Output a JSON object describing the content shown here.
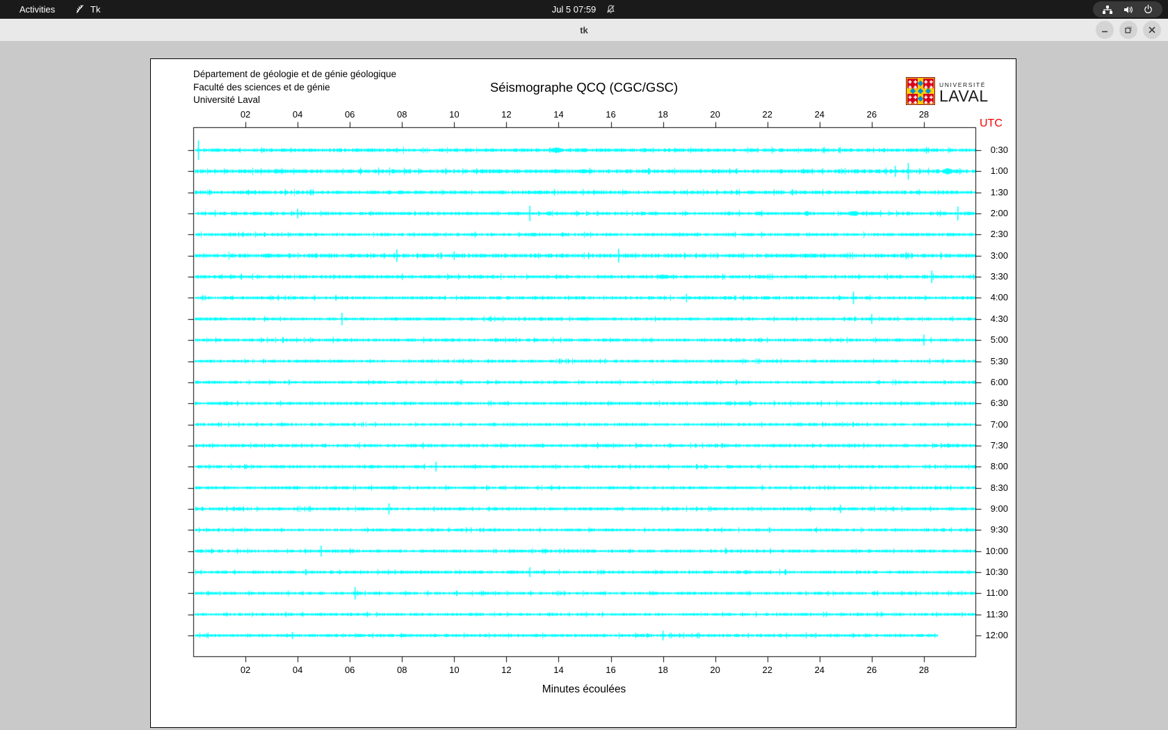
{
  "topbar": {
    "activities": "Activities",
    "app_name": "Tk",
    "clock": "Jul 5 07:59",
    "icon_names": [
      "tk-feather-icon",
      "bell-muted-icon",
      "network-icon",
      "volume-icon",
      "power-icon"
    ]
  },
  "titlebar": {
    "title": "tk",
    "controls": [
      "minimize",
      "maximize",
      "close"
    ]
  },
  "panel": {
    "dept_lines": [
      "Département de géologie et de génie géologique",
      "Faculté des sciences et de génie",
      "Université Laval"
    ],
    "title": "Séismographe QCQ (CGC/GSC)",
    "logo_top": "UNIVERSITÉ",
    "logo_bottom": "LAVAL"
  },
  "chart_data": {
    "type": "line",
    "subtype": "helicorder-seismogram",
    "title": "Séismographe QCQ (CGC/GSC)",
    "xlabel": "Minutes écoulées",
    "ylabel_right": "UTC",
    "x_range_minutes": [
      0,
      30
    ],
    "x_tick_minutes": [
      2,
      4,
      6,
      8,
      10,
      12,
      14,
      16,
      18,
      20,
      22,
      24,
      26,
      28
    ],
    "x_tick_labels": [
      "02",
      "04",
      "06",
      "08",
      "10",
      "12",
      "14",
      "16",
      "18",
      "20",
      "22",
      "24",
      "26",
      "28"
    ],
    "minutes_per_row": 30,
    "trace_color": "#00ffff",
    "axis_color": "#000000",
    "utc_color": "#f20000",
    "traces": [
      {
        "utc": "0:30",
        "amp": 1.8,
        "end": 30,
        "spikes": [
          {
            "m": 0.2,
            "a": 14
          }
        ],
        "bursts": [
          {
            "m": 13.9,
            "w": 0.6,
            "a": 4.5
          }
        ]
      },
      {
        "utc": "1:00",
        "amp": 2.0,
        "end": 30,
        "spikes": [
          {
            "m": 26.9,
            "a": 8
          },
          {
            "m": 27.4,
            "a": 12
          }
        ],
        "bursts": [
          {
            "m": 28.9,
            "w": 0.5,
            "a": 5
          }
        ]
      },
      {
        "utc": "1:30",
        "amp": 1.8,
        "end": 30,
        "spikes": [],
        "bursts": []
      },
      {
        "utc": "2:00",
        "amp": 1.7,
        "end": 30,
        "spikes": [
          {
            "m": 4.0,
            "a": 7
          },
          {
            "m": 12.9,
            "a": 11
          },
          {
            "m": 29.3,
            "a": 10
          }
        ],
        "bursts": [
          {
            "m": 23.5,
            "w": 0.4,
            "a": 3.5
          },
          {
            "m": 25.3,
            "w": 0.5,
            "a": 4.5
          }
        ]
      },
      {
        "utc": "2:30",
        "amp": 1.6,
        "end": 30,
        "spikes": [],
        "bursts": []
      },
      {
        "utc": "3:00",
        "amp": 2.0,
        "end": 30,
        "spikes": [
          {
            "m": 7.8,
            "a": 9
          },
          {
            "m": 9.5,
            "a": 5
          },
          {
            "m": 10.0,
            "a": 6
          },
          {
            "m": 16.3,
            "a": 10
          }
        ],
        "bursts": []
      },
      {
        "utc": "3:30",
        "amp": 1.7,
        "end": 30,
        "spikes": [
          {
            "m": 28.3,
            "a": 9
          }
        ],
        "bursts": [
          {
            "m": 18.0,
            "w": 0.8,
            "a": 3.5
          }
        ]
      },
      {
        "utc": "4:00",
        "amp": 1.6,
        "end": 30,
        "spikes": [
          {
            "m": 18.9,
            "a": 6
          },
          {
            "m": 25.3,
            "a": 9
          }
        ],
        "bursts": []
      },
      {
        "utc": "4:30",
        "amp": 1.6,
        "end": 30,
        "spikes": [
          {
            "m": 5.7,
            "a": 9
          },
          {
            "m": 26.0,
            "a": 7
          }
        ],
        "bursts": []
      },
      {
        "utc": "5:00",
        "amp": 1.6,
        "end": 30,
        "spikes": [
          {
            "m": 28.0,
            "a": 8
          }
        ],
        "bursts": []
      },
      {
        "utc": "5:30",
        "amp": 1.5,
        "end": 30,
        "spikes": [],
        "bursts": []
      },
      {
        "utc": "6:00",
        "amp": 1.5,
        "end": 30,
        "spikes": [],
        "bursts": []
      },
      {
        "utc": "6:30",
        "amp": 1.6,
        "end": 30,
        "spikes": [],
        "bursts": []
      },
      {
        "utc": "7:00",
        "amp": 1.5,
        "end": 30,
        "spikes": [],
        "bursts": []
      },
      {
        "utc": "7:30",
        "amp": 1.7,
        "end": 30,
        "spikes": [],
        "bursts": []
      },
      {
        "utc": "8:00",
        "amp": 1.6,
        "end": 30,
        "spikes": [
          {
            "m": 9.3,
            "a": 7
          }
        ],
        "bursts": []
      },
      {
        "utc": "8:30",
        "amp": 1.5,
        "end": 30,
        "spikes": [],
        "bursts": []
      },
      {
        "utc": "9:00",
        "amp": 1.6,
        "end": 30,
        "spikes": [
          {
            "m": 7.5,
            "a": 8
          },
          {
            "m": 24.8,
            "a": 6
          }
        ],
        "bursts": []
      },
      {
        "utc": "9:30",
        "amp": 1.5,
        "end": 30,
        "spikes": [],
        "bursts": []
      },
      {
        "utc": "10:00",
        "amp": 1.6,
        "end": 30,
        "spikes": [
          {
            "m": 4.9,
            "a": 8
          }
        ],
        "bursts": []
      },
      {
        "utc": "10:30",
        "amp": 1.6,
        "end": 30,
        "spikes": [
          {
            "m": 12.9,
            "a": 7
          }
        ],
        "bursts": []
      },
      {
        "utc": "11:00",
        "amp": 1.5,
        "end": 30,
        "spikes": [
          {
            "m": 6.2,
            "a": 9
          }
        ],
        "bursts": []
      },
      {
        "utc": "11:30",
        "amp": 1.5,
        "end": 30,
        "spikes": [],
        "bursts": []
      },
      {
        "utc": "12:00",
        "amp": 1.6,
        "end": 28.55,
        "spikes": [
          {
            "m": 3.8,
            "a": 5
          },
          {
            "m": 18.0,
            "a": 7
          }
        ],
        "bursts": []
      }
    ]
  }
}
